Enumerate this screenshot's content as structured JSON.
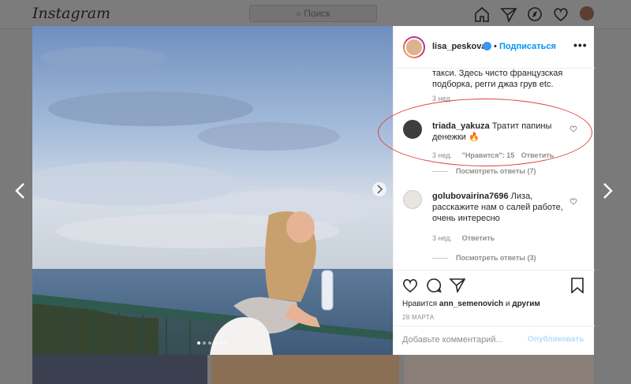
{
  "app": {
    "logo": "Instagram",
    "search_placeholder": "Поиск"
  },
  "post": {
    "username": "lisa_peskova",
    "follow_label": "Подписаться",
    "likes_prefix": "Нравится",
    "likes_user": "ann_semenovich",
    "likes_and": "и",
    "likes_others": "другим",
    "date": "28 МАРТА",
    "add_comment_placeholder": "Добавьте комментарий...",
    "publish_label": "Опубликовать"
  },
  "comments": {
    "truncated_line1": "такси. Здесь чисто французская",
    "truncated_line2": "подборка, регги джаз грув etc.",
    "truncated_time": "3 нед.",
    "c1": {
      "user": "triada_yakuza",
      "text_line1": "Тратит папины",
      "text_line2": "денежки",
      "emoji": "🔥",
      "time": "3 нед.",
      "likes": "\"Нравится\": 15",
      "reply": "Ответить",
      "view_replies": "Посмотреть ответы (7)"
    },
    "c2": {
      "user": "golubovairina7696",
      "text_line1": "Лиза,",
      "text_line2": "расскажите нам о салей работе,",
      "text_line3": "очень интересно",
      "time": "3 нед.",
      "reply": "Ответить",
      "view_replies": "Посмотреть ответы (3)"
    }
  },
  "colors": {
    "accent": "#0095f6",
    "verified": "#3897f0",
    "highlight": "#e04040"
  }
}
